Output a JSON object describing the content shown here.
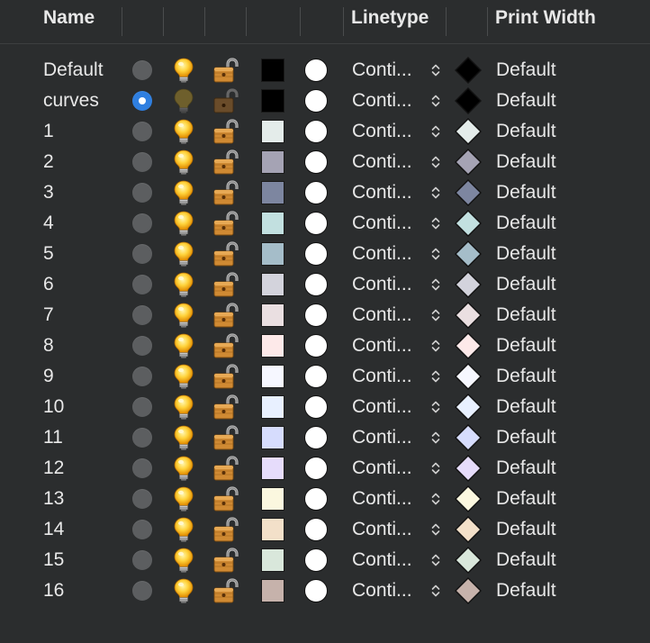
{
  "header": {
    "name_label": "Name",
    "linetype_label": "Linetype",
    "print_width_label": "Print Width"
  },
  "layers": [
    {
      "name": "Default",
      "current": false,
      "on": true,
      "locked": false,
      "color": "#000000",
      "linetype": "Conti...",
      "print_width": "Default"
    },
    {
      "name": "curves",
      "current": true,
      "on": false,
      "locked": false,
      "color": "#000000",
      "linetype": "Conti...",
      "print_width": "Default"
    },
    {
      "name": "1",
      "current": false,
      "on": true,
      "locked": false,
      "color": "#e4ecea",
      "linetype": "Conti...",
      "print_width": "Default"
    },
    {
      "name": "2",
      "current": false,
      "on": true,
      "locked": false,
      "color": "#a5a3b4",
      "linetype": "Conti...",
      "print_width": "Default"
    },
    {
      "name": "3",
      "current": false,
      "on": true,
      "locked": false,
      "color": "#7d86a0",
      "linetype": "Conti...",
      "print_width": "Default"
    },
    {
      "name": "4",
      "current": false,
      "on": true,
      "locked": false,
      "color": "#c2e0e0",
      "linetype": "Conti...",
      "print_width": "Default"
    },
    {
      "name": "5",
      "current": false,
      "on": true,
      "locked": false,
      "color": "#a5bdc9",
      "linetype": "Conti...",
      "print_width": "Default"
    },
    {
      "name": "6",
      "current": false,
      "on": true,
      "locked": false,
      "color": "#d3d3dc",
      "linetype": "Conti...",
      "print_width": "Default"
    },
    {
      "name": "7",
      "current": false,
      "on": true,
      "locked": false,
      "color": "#eadfe1",
      "linetype": "Conti...",
      "print_width": "Default"
    },
    {
      "name": "8",
      "current": false,
      "on": true,
      "locked": false,
      "color": "#fde9e9",
      "linetype": "Conti...",
      "print_width": "Default"
    },
    {
      "name": "9",
      "current": false,
      "on": true,
      "locked": false,
      "color": "#f6f7ff",
      "linetype": "Conti...",
      "print_width": "Default"
    },
    {
      "name": "10",
      "current": false,
      "on": true,
      "locked": false,
      "color": "#e8f0ff",
      "linetype": "Conti...",
      "print_width": "Default"
    },
    {
      "name": "11",
      "current": false,
      "on": true,
      "locked": false,
      "color": "#d6dcfd",
      "linetype": "Conti...",
      "print_width": "Default"
    },
    {
      "name": "12",
      "current": false,
      "on": true,
      "locked": false,
      "color": "#e6dcfb",
      "linetype": "Conti...",
      "print_width": "Default"
    },
    {
      "name": "13",
      "current": false,
      "on": true,
      "locked": false,
      "color": "#fbf7df",
      "linetype": "Conti...",
      "print_width": "Default"
    },
    {
      "name": "14",
      "current": false,
      "on": true,
      "locked": false,
      "color": "#f3e0c9",
      "linetype": "Conti...",
      "print_width": "Default"
    },
    {
      "name": "15",
      "current": false,
      "on": true,
      "locked": false,
      "color": "#d9e7db",
      "linetype": "Conti...",
      "print_width": "Default"
    },
    {
      "name": "16",
      "current": false,
      "on": true,
      "locked": false,
      "color": "#c6b2ab",
      "linetype": "Conti...",
      "print_width": "Default"
    }
  ],
  "icons": {
    "visibility": "lightbulb-icon",
    "lock": "padlock-icon",
    "linetype_menu": "chevron-up-down-icon",
    "print_color": "diamond-icon"
  }
}
